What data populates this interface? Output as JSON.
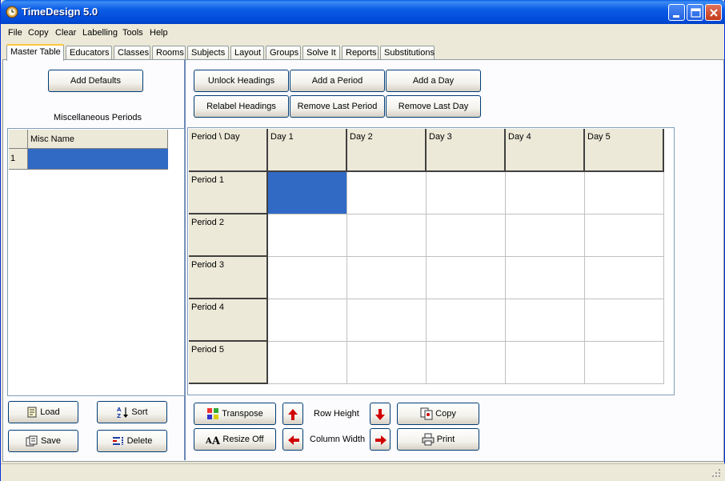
{
  "app": {
    "title": "TimeDesign 5.0",
    "icon": "app-clock-icon"
  },
  "window_controls": {
    "minimize_icon": "minimize-icon",
    "maximize_icon": "maximize-icon",
    "close_icon": "close-icon"
  },
  "menu": [
    "File",
    "Copy",
    "Clear",
    "Labelling",
    "Tools",
    "Help"
  ],
  "tabs": [
    "Master Table",
    "Educators",
    "Classes",
    "Rooms",
    "Subjects",
    "Layout",
    "Groups",
    "Solve It",
    "Reports",
    "Substitutions"
  ],
  "active_tab": "Master Table",
  "left_panel": {
    "add_defaults": "Add Defaults",
    "misc_label": "Miscellaneous Periods",
    "misc_grid": {
      "header": "Misc Name",
      "rows": [
        {
          "num": "1",
          "value": ""
        }
      ]
    },
    "load": "Load",
    "sort": "Sort",
    "save": "Save",
    "delete": "Delete"
  },
  "top_buttons": {
    "unlock_headings": "Unlock Headings",
    "add_period": "Add a Period",
    "add_day": "Add a Day",
    "relabel_headings": "Relabel Headings",
    "remove_last_period": "Remove Last Period",
    "remove_last_day": "Remove Last Day"
  },
  "master_grid": {
    "corner": "Period \\ Day",
    "days": [
      "Day 1",
      "Day 2",
      "Day 3",
      "Day 4",
      "Day 5"
    ],
    "periods": [
      "Period 1",
      "Period 2",
      "Period 3",
      "Period 4",
      "Period 5"
    ],
    "selected_cell": {
      "period": 1,
      "day": 1
    }
  },
  "bottom_controls": {
    "transpose": "Transpose",
    "resize_off": "Resize Off",
    "row_height": "Row Height",
    "column_width": "Column Width",
    "copy": "Copy",
    "print": "Print"
  },
  "colors": {
    "selection": "#316ac5",
    "titlebar": "#0a5ce6",
    "face": "#ece9d8"
  }
}
